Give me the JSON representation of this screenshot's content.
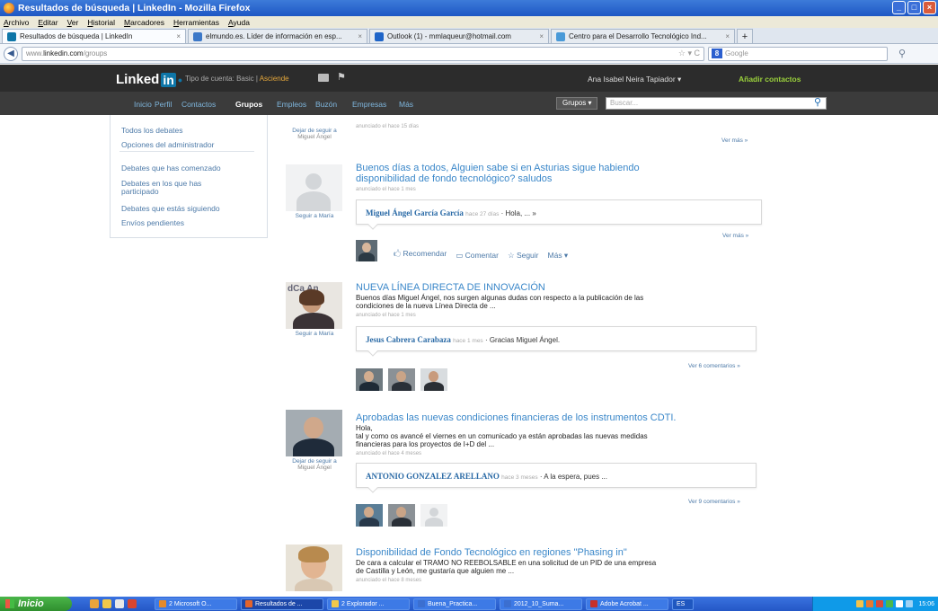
{
  "window": {
    "title": "Resultados de búsqueda | LinkedIn - Mozilla Firefox"
  },
  "menubar": [
    "Archivo",
    "Editar",
    "Ver",
    "Historial",
    "Marcadores",
    "Herramientas",
    "Ayuda"
  ],
  "tabs": [
    {
      "label": "Resultados de búsqueda | LinkedIn"
    },
    {
      "label": "elmundo.es. Líder de información en esp..."
    },
    {
      "label": "Outlook (1) - mmlaqueur@hotmail.com"
    },
    {
      "label": "Centro para el Desarrollo Tecnológico Ind..."
    }
  ],
  "navbar": {
    "url_prefix": "www.",
    "url_domain": "linkedin.com",
    "url_path": "/groups",
    "url_controls": "☆ ▾ C",
    "search_engine": "8",
    "search_placeholder": "Google"
  },
  "linkedin": {
    "logo_text": "Linked",
    "logo_in": "in",
    "logo_dot": "●",
    "account_label": "Tipo de cuenta: Basic |",
    "account_upgrade": "Asciende",
    "user_name": "Ana Isabel Neira Tapiador ▾",
    "add_contacts": "Añadir contactos",
    "nav": [
      "Inicio",
      "Perfil",
      "Contactos",
      "Grupos",
      "Empleos",
      "Buzón",
      "Empresas",
      "Más"
    ],
    "groups_button": "Grupos ▾",
    "search_placeholder": "Buscar..."
  },
  "sidebar": {
    "items": [
      "Todos los debates",
      "Opciones del administrador",
      "Debates que has comenzado",
      "Debates en los que has",
      "participado",
      "Debates que estás siguiendo",
      "Envíos pendientes"
    ]
  },
  "feed": {
    "top_caption_1": "Dejar de seguir a",
    "top_caption_2": "Miguel Ángel",
    "top_meta": "anunciado el hace 15 días",
    "ver_mas": "Ver más »",
    "posts": [
      {
        "title_1": "Buenos días a todos, Alguien sabe si en Asturias sigue habiendo",
        "title_2": "disponibilidad de fondo tecnológico? saludos",
        "meta": "anunciado el hace 1 mes",
        "poster_caption": "Seguir a María",
        "comment_author": "Miguel Ángel García García",
        "comment_time": "hace 27 días",
        "comment_text": "· Hola, ... »",
        "ver_link": "Ver más »"
      },
      {
        "title_1": "NUEVA LÍNEA DIRECTA DE INNOVACIÓN",
        "body_1": "Buenos días Miguel Ángel, nos surgen algunas dudas con respecto a la publicación de las",
        "body_2": "condiciones de la nueva Línea Directa de ...",
        "meta": "anunciado el hace 1 mes",
        "poster_caption": "Seguir a María",
        "comment_author": "Jesus Cabrera Carabaza",
        "comment_time": "hace 1 mes",
        "comment_text": "· Gracias Miguel Ángel.",
        "ver_link": "Ver 6 comentarios »",
        "photo_text": "dCa An"
      },
      {
        "title_1": "Aprobadas las nuevas condiciones financieras de los instrumentos CDTI.",
        "body_1": "Hola,",
        "body_2": "tal y como os avancé el viernes en un comunicado ya están aprobadas las nuevas medidas",
        "body_3": "financieras para los proyectos de I+D del ...",
        "meta": "anunciado el hace 4 meses",
        "poster_caption_1": "Dejar de seguir a",
        "poster_caption_2": "Miguel Ángel",
        "comment_author": "ANTONIO GONZALEZ ARELLANO",
        "comment_time": "hace 3 meses",
        "comment_text": "· A la espera, pues ...",
        "ver_link": "Ver 9 comentarios »"
      },
      {
        "title_1": "Disponibilidad de Fondo Tecnológico en regiones \"Phasing in\"",
        "body_1": "De cara a calcular el TRAMO NO REEBOLSABLE en una solicitud de un PID de una empresa",
        "body_2": "de Castilla y León, me gustaría que alguien me ...",
        "meta": "anunciado el hace 8 meses"
      }
    ],
    "actions": {
      "recommend": "Recomendar",
      "comment": "Comentar",
      "follow": "Seguir",
      "more": "Más ▾"
    }
  },
  "taskbar": {
    "start": "Inicio",
    "buttons": [
      "2 Microsoft O...",
      "Resultados de ...",
      "2 Explorador ...",
      "Buena_Practica...",
      "2012_10_Suma...",
      "Adobe Acrobat ...",
      "ES"
    ],
    "clock": "15:06"
  },
  "colors": {
    "linkedin_blue": "#0e76a8",
    "link_blue": "#3a87c9",
    "header_dark": "#2c2c2c",
    "add_contacts_green": "#9bd23c"
  }
}
